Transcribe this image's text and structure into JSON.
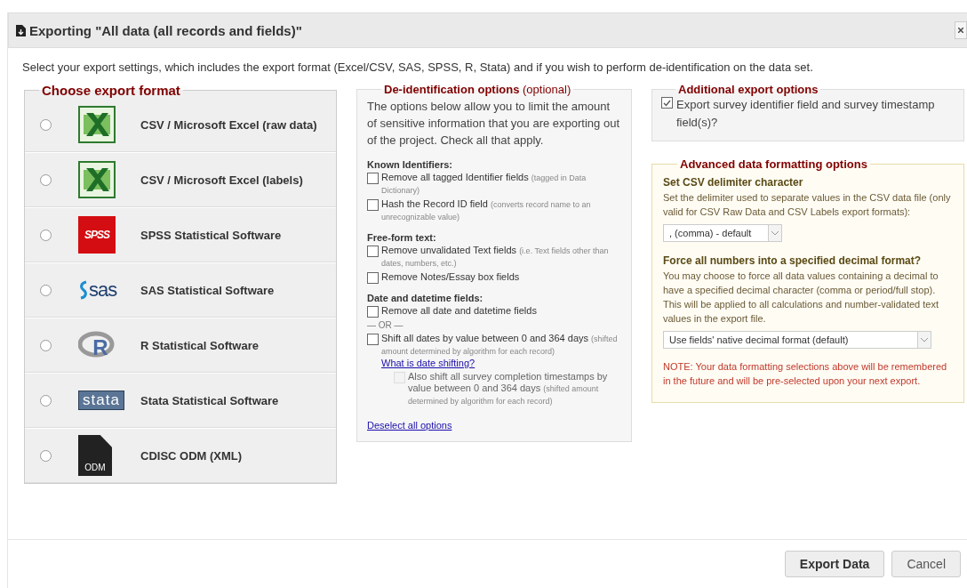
{
  "dialog": {
    "title": "Exporting \"All data (all records and fields)\""
  },
  "intro": "Select your export settings, which includes the export format (Excel/CSV, SAS, SPSS, R, Stata) and if you wish to perform de-identification on the data set.",
  "export_format": {
    "legend": "Choose export format",
    "formats": [
      {
        "kind": "excel",
        "label": "CSV / Microsoft Excel (raw data)",
        "selected": false
      },
      {
        "kind": "excel",
        "label": "CSV / Microsoft Excel (labels)",
        "selected": false
      },
      {
        "kind": "spss",
        "logo_text": "SPSS",
        "label": "SPSS Statistical Software",
        "selected": false
      },
      {
        "kind": "sas",
        "logo_text": "sas",
        "label": "SAS Statistical Software",
        "selected": false
      },
      {
        "kind": "r",
        "logo_text": "R",
        "label": "R Statistical Software",
        "selected": false
      },
      {
        "kind": "stata",
        "logo_text": "stata",
        "label": "Stata Statistical Software",
        "selected": false
      },
      {
        "kind": "odm",
        "logo_text": "ODM",
        "label": "CDISC ODM (XML)",
        "selected": false
      }
    ]
  },
  "deidentification": {
    "legend": "De-identification options",
    "legend_note": "(optional)",
    "description": "The options below allow you to limit the amount of sensitive information that you are exporting out of the project. Check all that apply.",
    "groups": [
      {
        "heading": "Known Identifiers:",
        "items": [
          {
            "kind": "checkbox",
            "label": "Remove all tagged Identifier fields",
            "note": "(tagged in Data Dictionary)",
            "checked": false
          },
          {
            "kind": "checkbox",
            "label": "Hash the Record ID field",
            "note": "(converts record name to an unrecognizable value)",
            "checked": false
          }
        ]
      },
      {
        "heading": "Free-form text:",
        "items": [
          {
            "kind": "checkbox",
            "label": "Remove unvalidated Text fields",
            "note": "(i.e. Text fields other than dates, numbers, etc.)",
            "checked": false
          },
          {
            "kind": "checkbox",
            "label": "Remove Notes/Essay box fields",
            "checked": false
          }
        ]
      },
      {
        "heading": "Date and datetime fields:",
        "items": [
          {
            "kind": "checkbox",
            "label": "Remove all date and datetime fields",
            "checked": false
          },
          {
            "kind": "separator",
            "text": "— OR —"
          },
          {
            "kind": "checkbox",
            "label": "Shift all dates by value between 0 and 364 days",
            "note": "(shifted amount determined by algorithm for each record)",
            "link": "What is date shifting?",
            "checked": false,
            "children": [
              {
                "kind": "checkbox",
                "label": "Also shift all survey completion timestamps by value between 0 and 364 days",
                "note": "(shifted amount determined by algorithm for each record)",
                "checked": false,
                "disabled": true
              }
            ]
          }
        ]
      }
    ],
    "deselect_link": "Deselect all options"
  },
  "additional_options": {
    "legend": "Additional export options",
    "option": {
      "label": "Export survey identifier field and survey timestamp field(s)?",
      "checked": true
    }
  },
  "advanced_formatting": {
    "legend": "Advanced data formatting options",
    "delimiter": {
      "heading": "Set CSV delimiter character",
      "description": "Set the delimiter used to separate values in the CSV data file (only valid for CSV Raw Data and CSV Labels export formats):",
      "value": ", (comma) - default"
    },
    "decimal": {
      "heading": "Force all numbers into a specified decimal format?",
      "description": "You may choose to force all data values containing a decimal to have a specified decimal character (comma or period/full stop). This will be applied to all calculations and number-validated text values in the export file.",
      "value": "Use fields' native decimal format (default)"
    },
    "note": "NOTE: Your data formatting selections above will be remembered in the future and will be pre-selected upon your next export."
  },
  "buttons": [
    {
      "label": "Export Data",
      "primary": true
    },
    {
      "label": "Cancel",
      "primary": false
    }
  ]
}
